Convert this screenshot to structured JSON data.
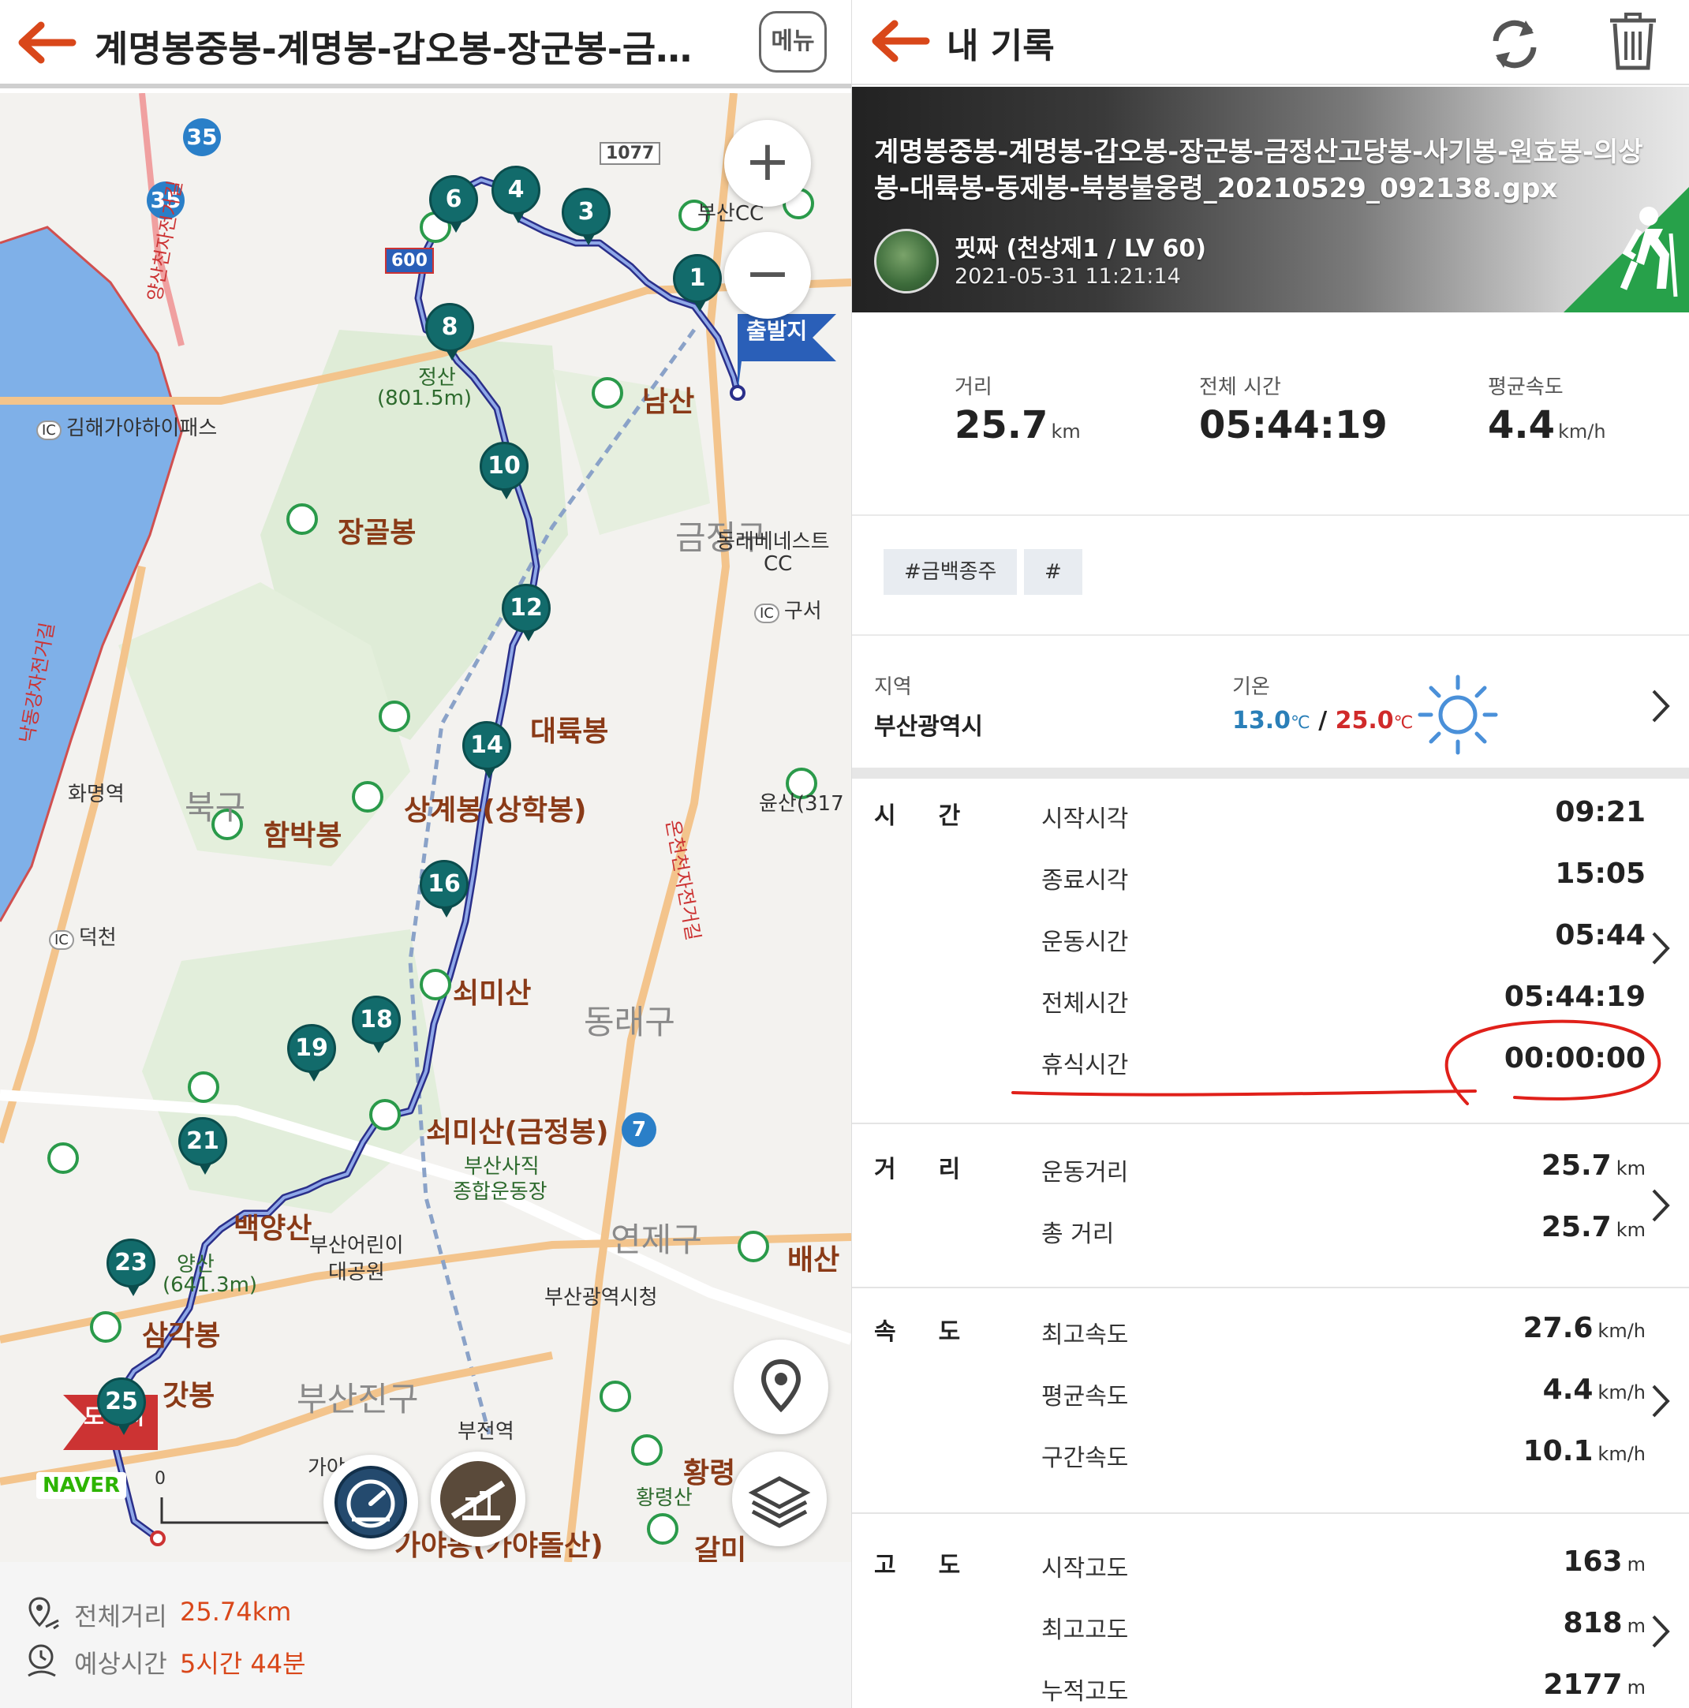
{
  "left": {
    "header": {
      "title": "계명봉중봉-계명봉-갑오봉-장군봉-금정...",
      "menu_label": "메뉴"
    },
    "map": {
      "brand": "NAVER",
      "scale_zero": "0",
      "labels": {
        "namsan": "남산",
        "janggolbong": "장골봉",
        "daeryukbong": "대륙봉",
        "sanggyebong": "상계봉(상학봉)",
        "hambakbong": "함박봉",
        "buk_gu": "북구",
        "soemisan": "쇠미산",
        "soemisan2": "쇠미산(금정봉)",
        "dongnae_gu": "동래구",
        "yeonje_gu": "연제구",
        "baeksan": "배산",
        "baekyangsan": "백양산",
        "baekyangsan_h1": "양산",
        "baekyangsan_h2": "(641.3m)",
        "samgakbong": "삼각봉",
        "gatbong": "갓봉",
        "busanjin_gu": "부산진구",
        "hwangnyeong": "황령",
        "hwangnyeongsan": "황령산",
        "galmi": "갈미",
        "geumjeong_gu": "금정구",
        "dongnae_cc": "동래베네스트",
        "dongnae_cc2": "CC",
        "busan_cc": "부산CC",
        "geumjeongsan_h1": "정산",
        "geumjeongsan_h2": "(801.5m)",
        "gimhae_ic": "김해가야하이패스",
        "guseo_ic": "구서",
        "deokcheon_ic": "덕천",
        "hwamyeong": "화명역",
        "sajik": "부산사직",
        "sajik2": "종합운동장",
        "children": "부산어린이",
        "children2": "대공원",
        "city_hall": "부산광역시청",
        "bujeon": "부전역",
        "gaya": "가야",
        "gayadong": "가야동(가야돌산)",
        "start_flag": "출발지",
        "end_flag": "도착지",
        "yunsan": "윤산(317",
        "road_35a": "35",
        "road_35b": "35",
        "road_1077": "1077",
        "road_600": "600",
        "road_7": "7",
        "yangsan_road": "양산천자전거길",
        "nakdong_road": "낙동강자전거길",
        "oncheon_road": "온천천자전거길"
      },
      "waypoints": [
        "1",
        "3",
        "4",
        "6",
        "8",
        "10",
        "12",
        "14",
        "16",
        "18",
        "19",
        "21",
        "23",
        "25"
      ]
    },
    "footer": {
      "distance_label": "전체거리",
      "distance_value": "25.74km",
      "time_label": "예상시간",
      "time_value": "5시간 44분"
    }
  },
  "right": {
    "header": {
      "title": "내 기록"
    },
    "banner": {
      "title": "계명봉중봉-계명봉-갑오봉-장군봉-금정산고당봉-사기봉-원효봉-의상봉-대륙봉-동제봉-북봉불웅령_20210529_092138.gpx",
      "user": "핏짜 (천상제1 / LV 60)",
      "date": "2021-05-31 11:21:14"
    },
    "stats": {
      "distance_label": "거리",
      "distance_value": "25.7",
      "distance_unit": "km",
      "total_time_label": "전체 시간",
      "total_time_value": "05:44:19",
      "avg_speed_label": "평균속도",
      "avg_speed_value": "4.4",
      "avg_speed_unit": "km/h"
    },
    "tags": [
      "#금백종주",
      "#"
    ],
    "region": {
      "region_label": "지역",
      "region_value": "부산광역시",
      "temp_label": "기온",
      "temp_low": "13.0",
      "temp_sep": "/",
      "temp_high": "25.0",
      "temp_unit": "℃",
      "weather_icon": "sun-icon"
    },
    "time": {
      "header": "시간",
      "rows": [
        {
          "label": "시작시각",
          "value": "09:21"
        },
        {
          "label": "종료시각",
          "value": "15:05"
        },
        {
          "label": "운동시간",
          "value": "05:44"
        },
        {
          "label": "전체시간",
          "value": "05:44:19"
        },
        {
          "label": "휴식시간",
          "value": "00:00:00"
        }
      ]
    },
    "distance": {
      "header": "거리",
      "rows": [
        {
          "label": "운동거리",
          "value": "25.7",
          "unit": "km"
        },
        {
          "label": "총 거리",
          "value": "25.7",
          "unit": "km"
        }
      ]
    },
    "speed": {
      "header": "속도",
      "rows": [
        {
          "label": "최고속도",
          "value": "27.6",
          "unit": "km/h"
        },
        {
          "label": "평균속도",
          "value": "4.4",
          "unit": "km/h"
        },
        {
          "label": "구간속도",
          "value": "10.1",
          "unit": "km/h"
        }
      ]
    },
    "altitude": {
      "header": "고도",
      "rows": [
        {
          "label": "시작고도",
          "value": "163",
          "unit": "m"
        },
        {
          "label": "최고고도",
          "value": "818",
          "unit": "m"
        },
        {
          "label": "누적고도",
          "value": "2177",
          "unit": "m"
        }
      ]
    },
    "colors": {
      "accent": "#d9471a",
      "temp_low": "#2a7fb8",
      "temp_high": "#d02a2a",
      "annotation": "#e0201a"
    }
  }
}
